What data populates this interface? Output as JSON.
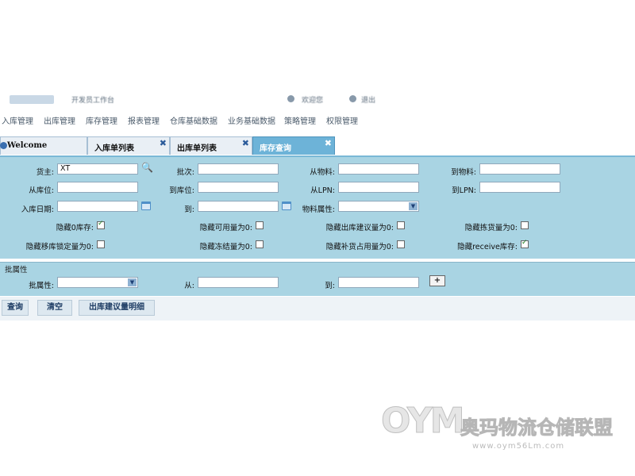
{
  "top_strip": {
    "fragments": [
      "开发员工作台",
      "欢迎您",
      "退出"
    ]
  },
  "menu": {
    "items": [
      "入库管理",
      "出库管理",
      "库存管理",
      "报表管理",
      "仓库基础数据",
      "业务基础数据",
      "策略管理",
      "权限管理"
    ]
  },
  "tabs": [
    {
      "label": "Welcome",
      "closable": false,
      "active": false
    },
    {
      "label": "入库单列表",
      "closable": true,
      "active": false
    },
    {
      "label": "出库单列表",
      "closable": true,
      "active": false
    },
    {
      "label": "库存查询",
      "closable": true,
      "active": true
    }
  ],
  "form": {
    "owner_label": "货主:",
    "owner_value": "XT",
    "batch_label": "批次:",
    "batch_value": "",
    "from_material_label": "从物料:",
    "from_material_value": "",
    "to_material_label": "到物料:",
    "to_material_value": "",
    "from_location_label": "从库位:",
    "from_location_value": "",
    "to_location_label": "到库位:",
    "to_location_value": "",
    "from_lpn_label": "从LPN:",
    "from_lpn_value": "",
    "to_lpn_label": "到LPN:",
    "to_lpn_value": "",
    "inbound_date_label": "入库日期:",
    "inbound_date_value": "",
    "to_date_label": "到:",
    "to_date_value": "",
    "material_attr_label": "物料属性:",
    "material_attr_value": ""
  },
  "checkboxes": [
    {
      "label": "隐藏0库存:",
      "checked": true
    },
    {
      "label": "隐藏可用量为0:",
      "checked": false
    },
    {
      "label": "隐藏出库建议量为0:",
      "checked": false
    },
    {
      "label": "隐藏拣货量为0:",
      "checked": false
    },
    {
      "label": "隐藏移库锁定量为0:",
      "checked": false
    },
    {
      "label": "隐藏冻结量为0:",
      "checked": false
    },
    {
      "label": "隐藏补货占用量为0:",
      "checked": false
    },
    {
      "label": "隐藏receive库存:",
      "checked": true
    }
  ],
  "batch_section": {
    "title": "批属性",
    "attr_label": "批属性:",
    "attr_value": "",
    "from_label": "从:",
    "from_value": "",
    "to_label": "到:",
    "to_value": "",
    "add_label": "+"
  },
  "buttons": {
    "query": "查询",
    "clear": "清空",
    "outbound_detail": "出库建议量明细"
  },
  "watermark": {
    "logo_text": "OYM",
    "name": "奥玛物流仓储联盟",
    "url": "www.oym56Lm.com"
  },
  "colors": {
    "panel_bg": "#a9d4e3",
    "active_tab": "#6db3d8",
    "button_text": "#1c3b63"
  }
}
